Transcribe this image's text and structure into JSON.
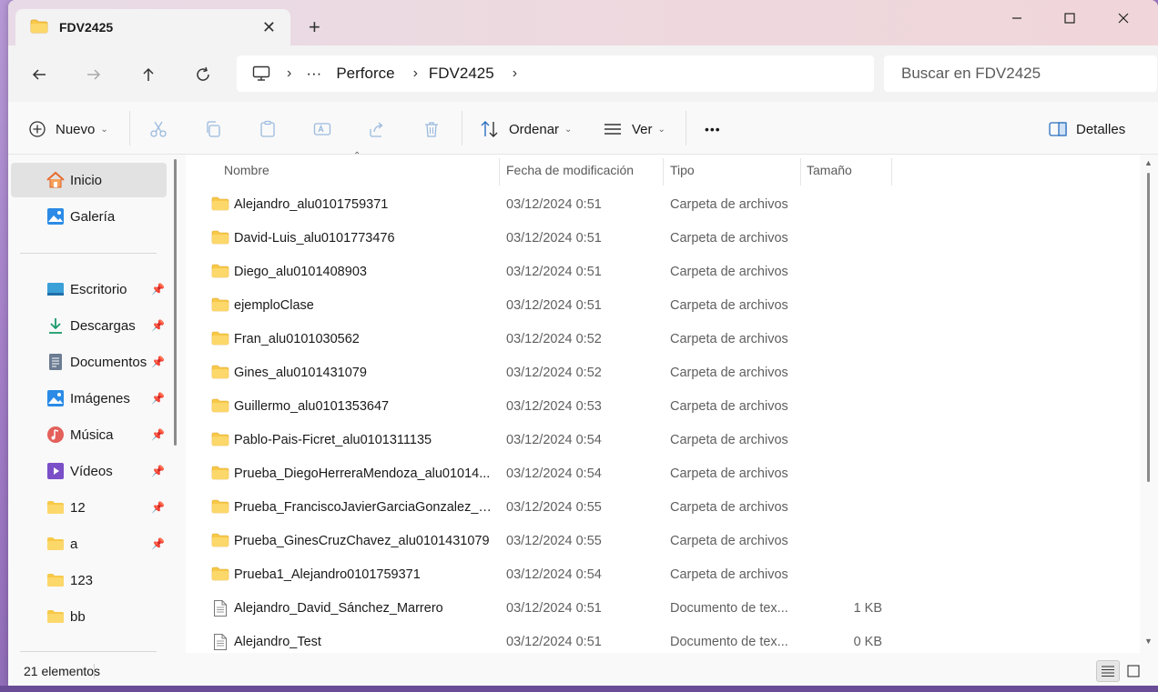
{
  "window": {
    "tab_title": "FDV2425",
    "tab_close": "✕",
    "new_tab": "+"
  },
  "address": {
    "more": "···",
    "crumbs": [
      "Perforce",
      "FDV2425"
    ],
    "sep": "›"
  },
  "search": {
    "placeholder": "Buscar en FDV2425"
  },
  "toolbar": {
    "new_label": "Nuevo",
    "sort_label": "Ordenar",
    "view_label": "Ver",
    "more_label": "•••",
    "details_label": "Detalles"
  },
  "sidebar": {
    "items": [
      {
        "label": "Inicio",
        "icon": "home-icon"
      },
      {
        "label": "Galería",
        "icon": "gallery-icon"
      },
      {
        "label": "Escritorio",
        "icon": "desktop-icon"
      },
      {
        "label": "Descargas",
        "icon": "download-icon"
      },
      {
        "label": "Documentos",
        "icon": "documents-icon"
      },
      {
        "label": "Imágenes",
        "icon": "pictures-icon"
      },
      {
        "label": "Música",
        "icon": "music-icon"
      },
      {
        "label": "Vídeos",
        "icon": "videos-icon"
      },
      {
        "label": "12",
        "icon": "folder-icon"
      },
      {
        "label": "a",
        "icon": "folder-icon"
      },
      {
        "label": "123",
        "icon": "folder-icon"
      },
      {
        "label": "bb",
        "icon": "folder-icon"
      }
    ]
  },
  "columns": {
    "name": "Nombre",
    "date": "Fecha de modificación",
    "type": "Tipo",
    "size": "Tamaño"
  },
  "files": [
    {
      "name": "Alejandro_alu0101759371",
      "date": "03/12/2024 0:51",
      "type": "Carpeta de archivos",
      "size": "",
      "kind": "folder"
    },
    {
      "name": "David-Luis_alu0101773476",
      "date": "03/12/2024 0:51",
      "type": "Carpeta de archivos",
      "size": "",
      "kind": "folder"
    },
    {
      "name": "Diego_alu0101408903",
      "date": "03/12/2024 0:51",
      "type": "Carpeta de archivos",
      "size": "",
      "kind": "folder"
    },
    {
      "name": "ejemploClase",
      "date": "03/12/2024 0:51",
      "type": "Carpeta de archivos",
      "size": "",
      "kind": "folder"
    },
    {
      "name": "Fran_alu0101030562",
      "date": "03/12/2024 0:52",
      "type": "Carpeta de archivos",
      "size": "",
      "kind": "folder"
    },
    {
      "name": "Gines_alu0101431079",
      "date": "03/12/2024 0:52",
      "type": "Carpeta de archivos",
      "size": "",
      "kind": "folder"
    },
    {
      "name": "Guillermo_alu0101353647",
      "date": "03/12/2024 0:53",
      "type": "Carpeta de archivos",
      "size": "",
      "kind": "folder"
    },
    {
      "name": "Pablo-Pais-Ficret_alu0101311135",
      "date": "03/12/2024 0:54",
      "type": "Carpeta de archivos",
      "size": "",
      "kind": "folder"
    },
    {
      "name": "Prueba_DiegoHerreraMendoza_alu01014...",
      "date": "03/12/2024 0:54",
      "type": "Carpeta de archivos",
      "size": "",
      "kind": "folder"
    },
    {
      "name": "Prueba_FranciscoJavierGarciaGonzalez_al...",
      "date": "03/12/2024 0:55",
      "type": "Carpeta de archivos",
      "size": "",
      "kind": "folder"
    },
    {
      "name": "Prueba_GinesCruzChavez_alu0101431079",
      "date": "03/12/2024 0:55",
      "type": "Carpeta de archivos",
      "size": "",
      "kind": "folder"
    },
    {
      "name": "Prueba1_Alejandro0101759371",
      "date": "03/12/2024 0:54",
      "type": "Carpeta de archivos",
      "size": "",
      "kind": "folder"
    },
    {
      "name": "Alejandro_David_Sánchez_Marrero",
      "date": "03/12/2024 0:51",
      "type": "Documento de tex...",
      "size": "1 KB",
      "kind": "text"
    },
    {
      "name": "Alejandro_Test",
      "date": "03/12/2024 0:51",
      "type": "Documento de tex...",
      "size": "0 KB",
      "kind": "text"
    }
  ],
  "status": {
    "count": "21 elementos"
  }
}
